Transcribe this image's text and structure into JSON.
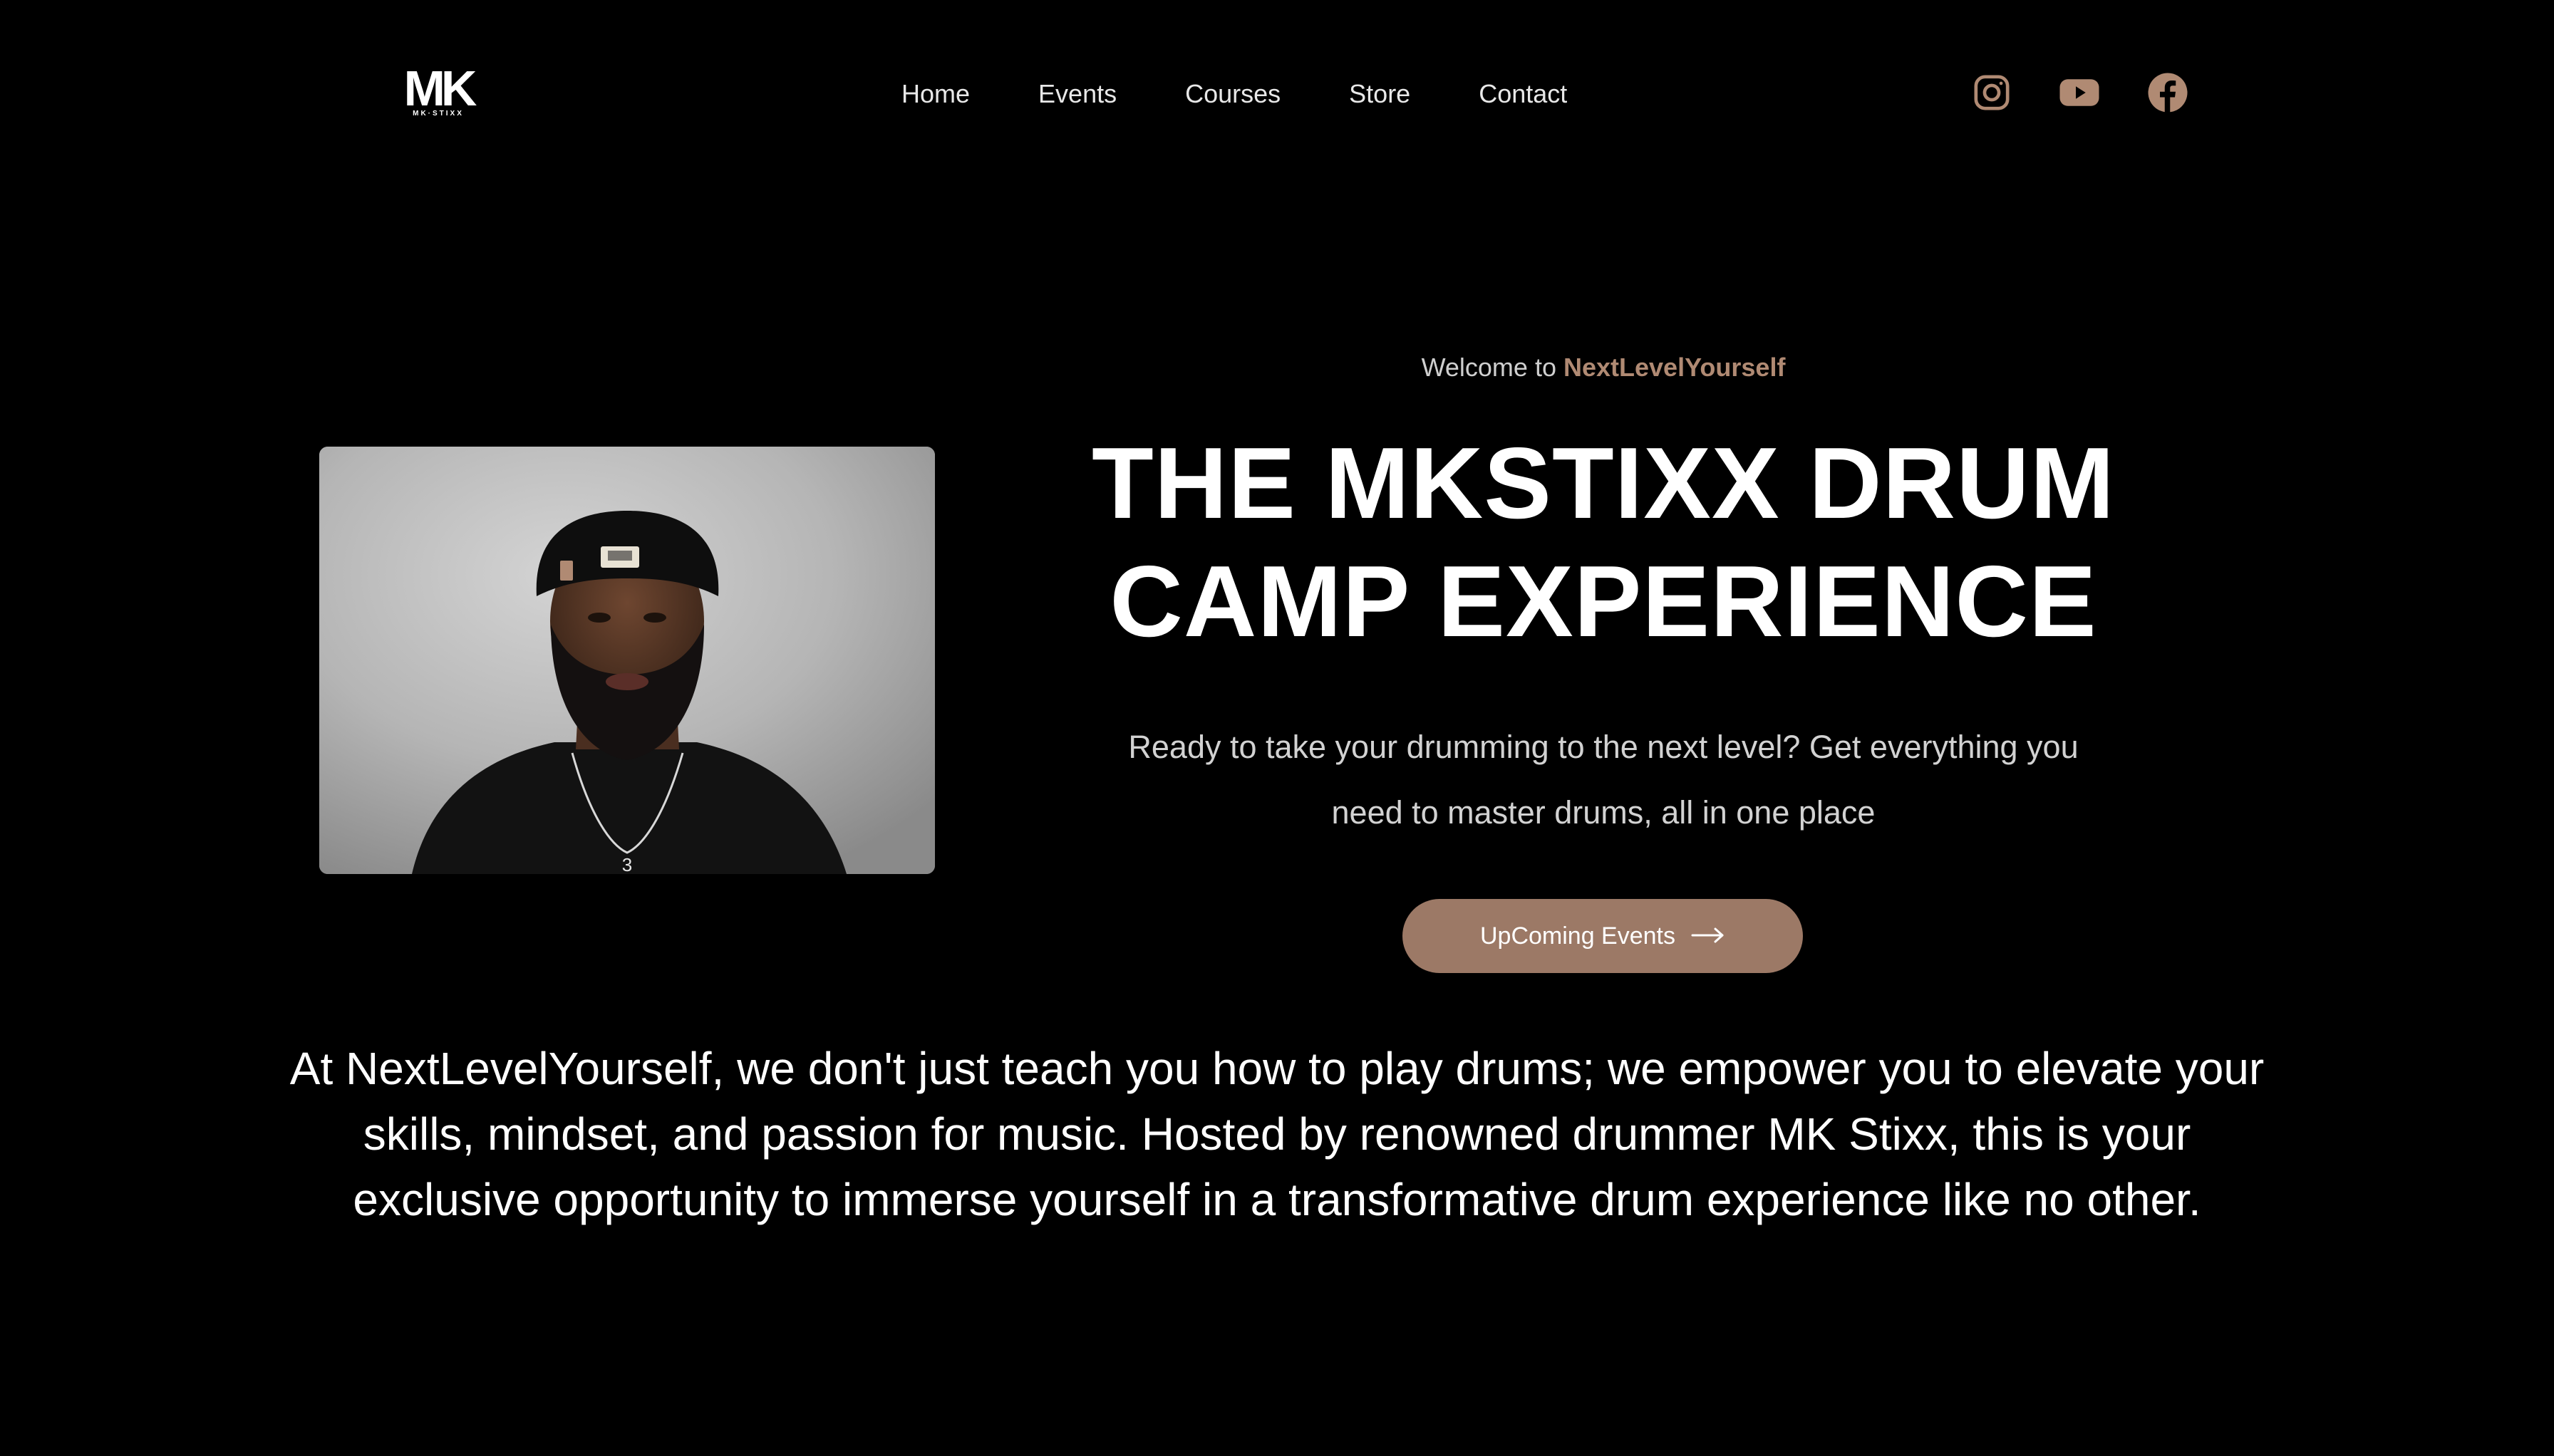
{
  "header": {
    "logo_text": "MK",
    "logo_subtext": "MK·STIXX",
    "nav": [
      {
        "label": "Home"
      },
      {
        "label": "Events"
      },
      {
        "label": "Courses"
      },
      {
        "label": "Store"
      },
      {
        "label": "Contact"
      }
    ],
    "social": [
      {
        "icon": "instagram-icon"
      },
      {
        "icon": "youtube-icon"
      },
      {
        "icon": "facebook-icon"
      }
    ]
  },
  "hero": {
    "welcome_prefix": "Welcome to",
    "welcome_brand": "NextLevelYourself",
    "title_line1": "THE MKSTIXX DRUM",
    "title_line2": "CAMP EXPERIENCE",
    "subtitle": "Ready to take your drumming to the next level? Get everything you need to master drums, all in one place",
    "cta_label": "UpComing Events",
    "cta_icon": "arrow-right-icon",
    "photo_pendant_text": "3"
  },
  "intro": {
    "text": "At NextLevelYourself, we don't just teach you how to play drums; we empower you to elevate your skills, mindset, and passion for music. Hosted by renowned drummer MK Stixx, this is your exclusive opportunity to immerse yourself in a transformative drum experience like no other."
  },
  "colors": {
    "background": "#000000",
    "accent": "#9c7966",
    "brand_text": "#b08a73",
    "icon": "#b08a73",
    "text": "#ffffff"
  }
}
